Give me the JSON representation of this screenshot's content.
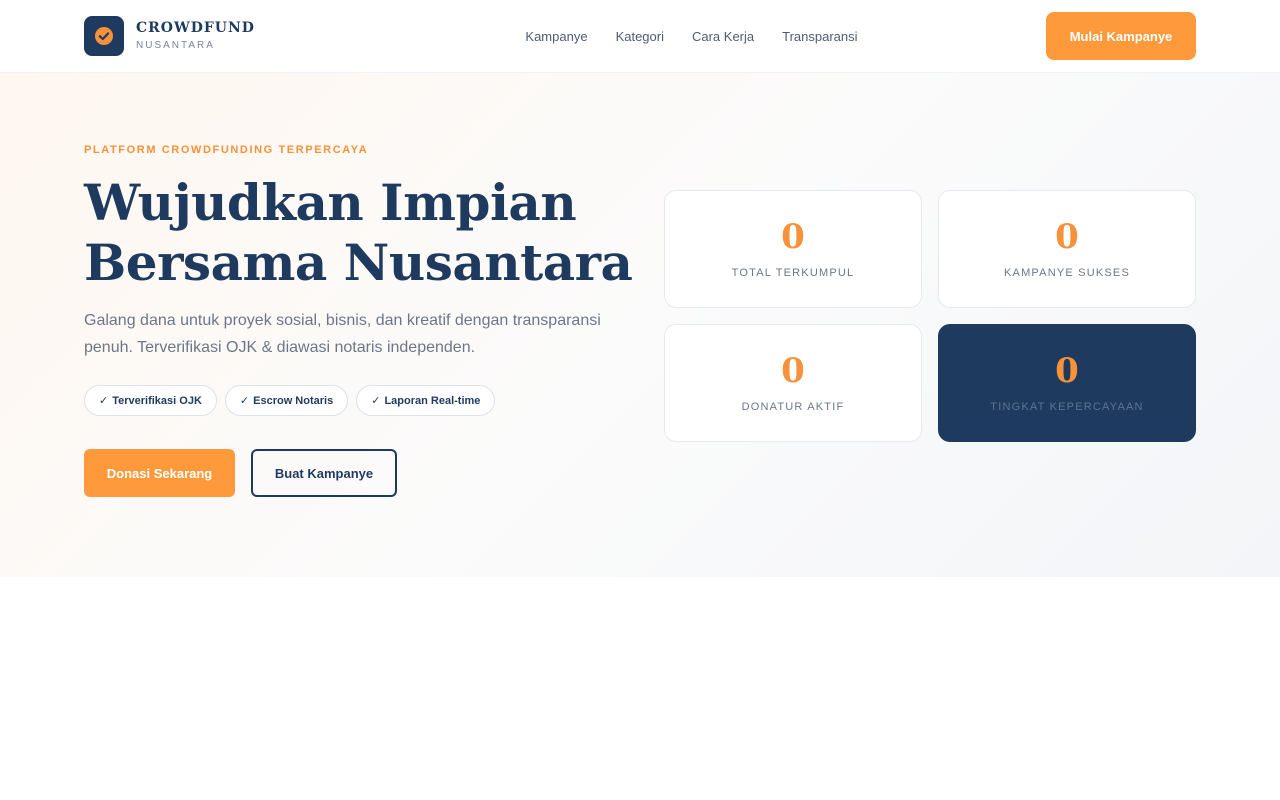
{
  "brand": {
    "name": "CROWDFUND",
    "subtitle": "NUSANTARA"
  },
  "nav": {
    "items": [
      {
        "label": "Kampanye"
      },
      {
        "label": "Kategori"
      },
      {
        "label": "Cara Kerja"
      },
      {
        "label": "Transparansi"
      }
    ],
    "cta_label": "Mulai Kampanye"
  },
  "hero": {
    "eyebrow": "PLATFORM CROWDFUNDING TERPERCAYA",
    "title_line1": "Wujudkan Impian",
    "title_line2": "Bersama Nusantara",
    "lead": "Galang dana untuk proyek sosial, bisnis, dan kreatif dengan transparansi penuh. Terverifikasi OJK & diawasi notaris independen.",
    "badges": [
      {
        "check": "✓",
        "label": "Terverifikasi OJK"
      },
      {
        "check": "✓",
        "label": "Escrow Notaris"
      },
      {
        "check": "✓",
        "label": "Laporan Real-time"
      }
    ],
    "primary_button": "Donasi Sekarang",
    "secondary_button": "Buat Kampanye"
  },
  "stats": [
    {
      "value": "0",
      "label": "TOTAL TERKUMPUL"
    },
    {
      "value": "0",
      "label": "KAMPANYE SUKSES"
    },
    {
      "value": "0",
      "label": "DONATUR AKTIF"
    },
    {
      "value": "0",
      "label": "TINGKAT KEPERCAYAAN"
    }
  ],
  "colors": {
    "primary_navy": "#1e3a5f",
    "accent_orange": "#ff9a3c",
    "muted_text": "#6b7789"
  },
  "icons": {
    "logo": "check-circle-icon",
    "badge": "check-mark-icon"
  }
}
